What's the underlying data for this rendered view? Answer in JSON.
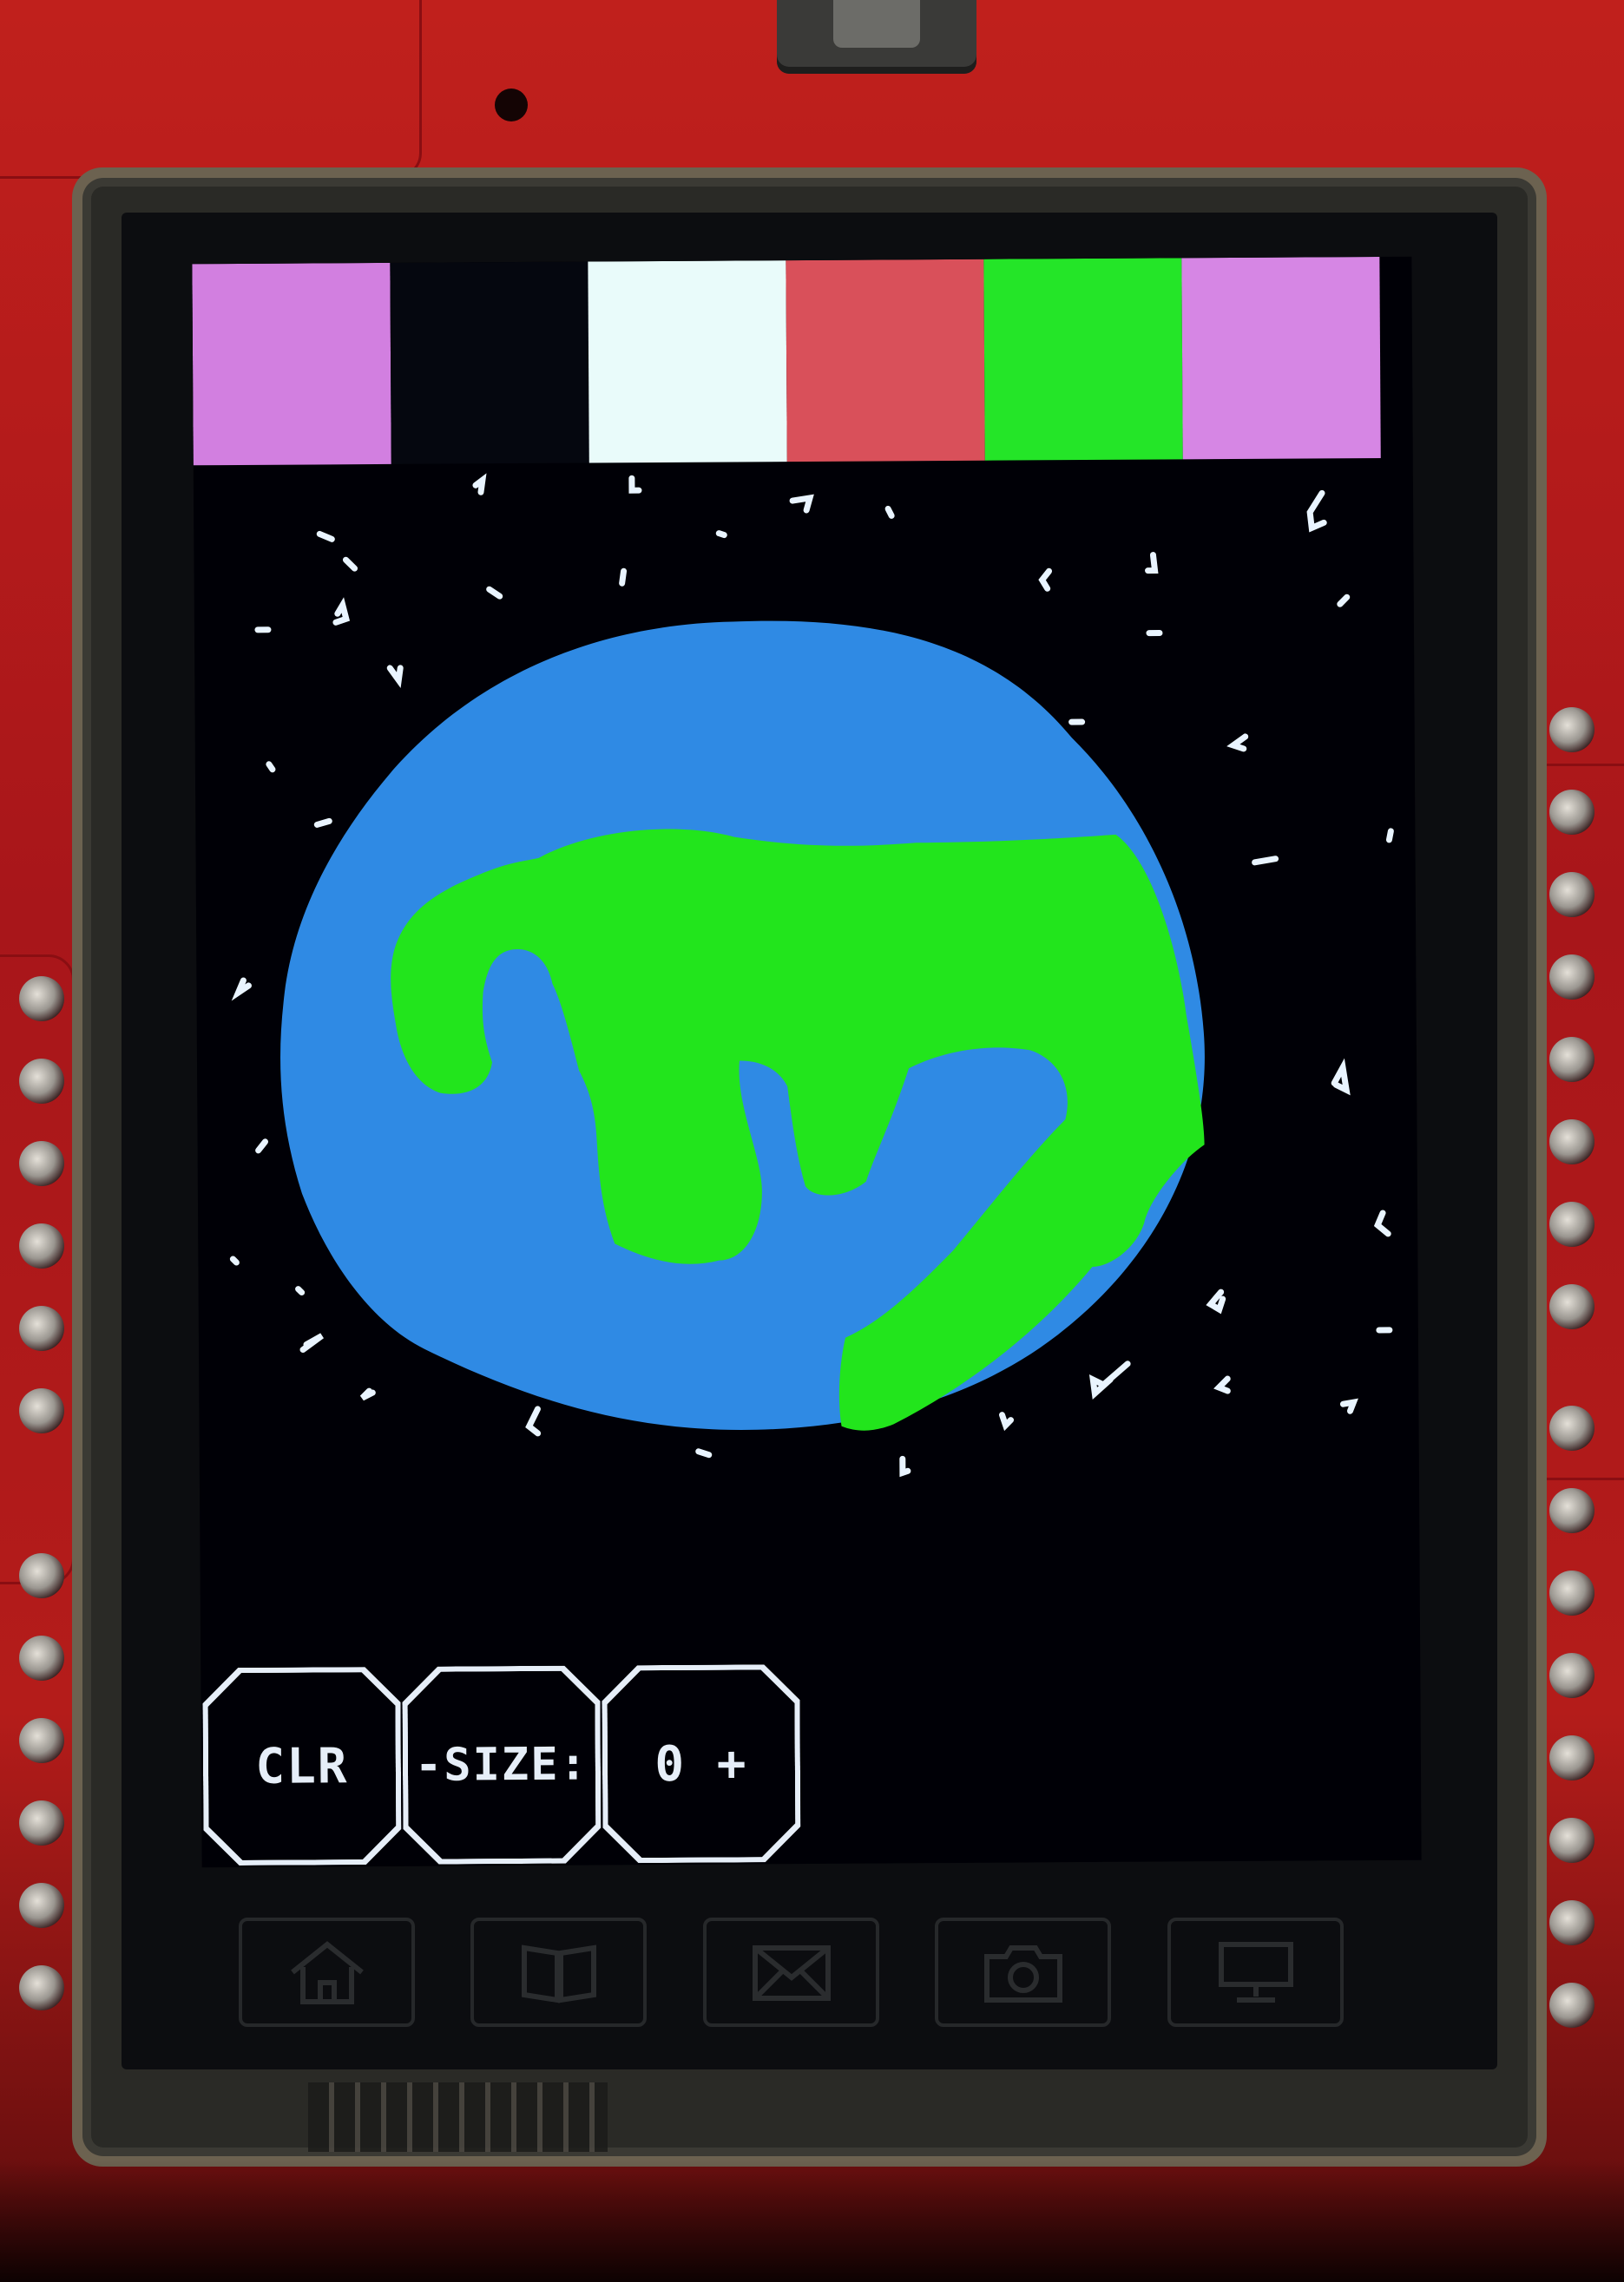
{
  "palette": {
    "swatches": [
      {
        "name": "violet",
        "color": "#d27fe0"
      },
      {
        "name": "black",
        "color": "#05070f"
      },
      {
        "name": "white",
        "color": "#e9fbfa"
      },
      {
        "name": "red",
        "color": "#d9505a"
      },
      {
        "name": "green",
        "color": "#24e528"
      },
      {
        "name": "violet",
        "color": "#d686e4"
      }
    ]
  },
  "toolbar": {
    "clear_label": "CLR",
    "size_label": "-SIZE:",
    "size_value": "0 +"
  },
  "drawing": {
    "background_color": "#000006",
    "planet_color": "#2f8ae4",
    "land_color": "#22e51c",
    "star_color": "#e9f4ff"
  },
  "softkeys": [
    {
      "icon": "home-icon"
    },
    {
      "icon": "book-icon"
    },
    {
      "icon": "mail-icon"
    },
    {
      "icon": "camera-icon"
    },
    {
      "icon": "computer-icon"
    }
  ],
  "colors": {
    "pcb": "#b41c1a",
    "button_outline": "#e6eef8"
  }
}
